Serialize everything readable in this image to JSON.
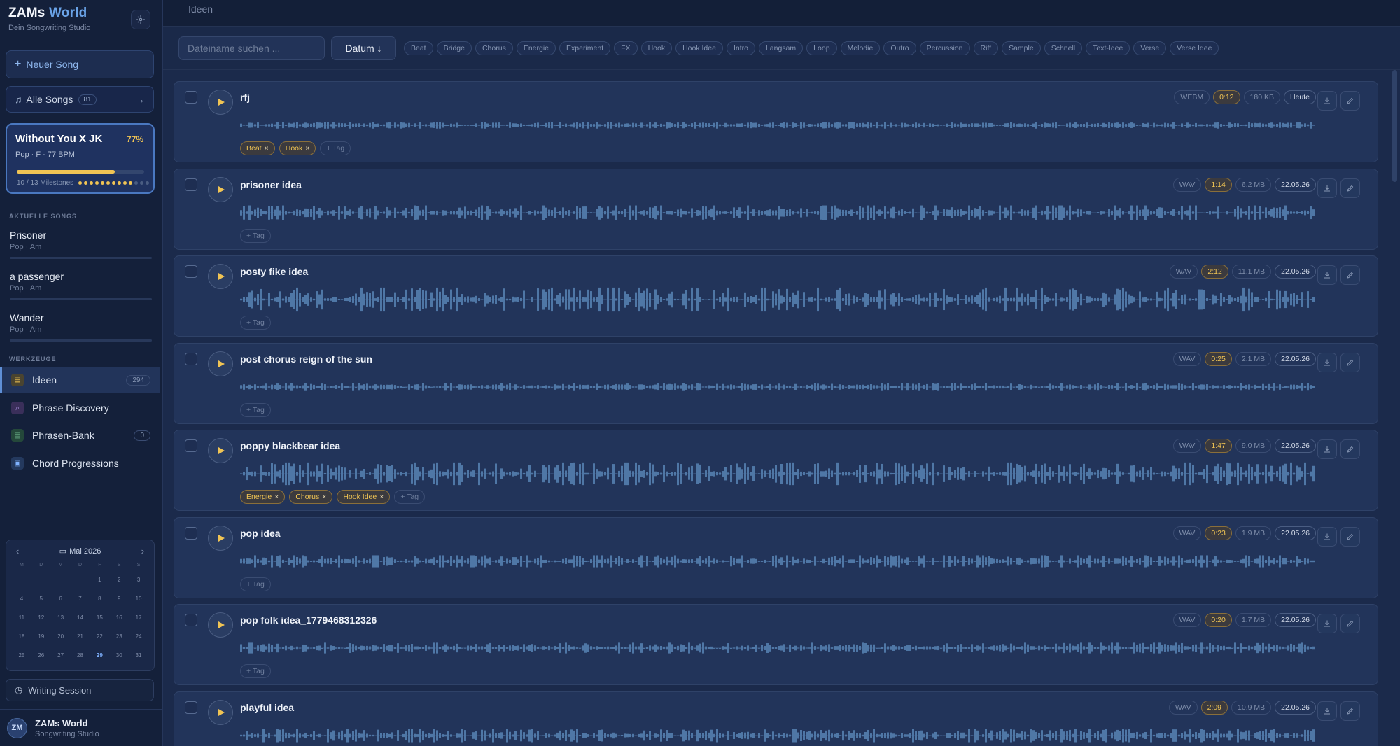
{
  "app": {
    "title_main": "ZAMs",
    "title_accent": "World",
    "subtitle": "Dein Songwriting Studio"
  },
  "sidebar": {
    "new_song": "Neuer Song",
    "all_songs": {
      "label": "Alle Songs",
      "count": "81"
    },
    "current_song": {
      "title": "Without You X JK",
      "percent": "77%",
      "progress": 0.77,
      "meta": "Pop · F · 77 BPM",
      "milestones": "10 / 13 Milestones",
      "milestones_done": 10,
      "milestones_total": 13
    },
    "recent_label": "AKTUELLE SONGS",
    "recent": [
      {
        "name": "Prisoner",
        "sub": "Pop · Am"
      },
      {
        "name": "a passenger",
        "sub": "Pop · Am"
      },
      {
        "name": "Wander",
        "sub": "Pop · Am"
      }
    ],
    "tools_label": "WERKZEUGE",
    "tools": [
      {
        "label": "Ideen",
        "badge": "294"
      },
      {
        "label": "Phrase Discovery",
        "badge": ""
      },
      {
        "label": "Phrasen-Bank",
        "badge": "0"
      },
      {
        "label": "Chord Progressions",
        "badge": ""
      }
    ],
    "calendar": {
      "month": "Mai 2026",
      "weekdays": [
        "M",
        "D",
        "M",
        "D",
        "F",
        "S",
        "S"
      ],
      "days": [
        "",
        "",
        "",
        "",
        "1",
        "2",
        "3",
        "4",
        "5",
        "6",
        "7",
        "8",
        "9",
        "10",
        "11",
        "12",
        "13",
        "14",
        "15",
        "16",
        "17",
        "18",
        "19",
        "20",
        "21",
        "22",
        "23",
        "24",
        "25",
        "26",
        "27",
        "28",
        "29",
        "30",
        "31"
      ],
      "today": "29"
    },
    "writing_session": "Writing Session",
    "footer": {
      "initials": "ZM",
      "name": "ZAMs World",
      "sub": "Songwriting Studio"
    }
  },
  "main": {
    "breadcrumb": "Ideen",
    "search_placeholder": "Dateiname suchen ...",
    "sort_label": "Datum ↓",
    "filter_tags": [
      "Beat",
      "Bridge",
      "Chorus",
      "Energie",
      "Experiment",
      "FX",
      "Hook",
      "Hook Idee",
      "Intro",
      "Langsam",
      "Loop",
      "Melodie",
      "Outro",
      "Percussion",
      "Riff",
      "Sample",
      "Schnell",
      "Text-Idee",
      "Verse",
      "Verse Idee"
    ],
    "add_tag_label": "+ Tag",
    "ideas": [
      {
        "title": "rfj",
        "format": "WEBM",
        "duration": "0:12",
        "size": "180 KB",
        "date": "Heute",
        "tags": [
          "Beat",
          "Hook"
        ]
      },
      {
        "title": "prisoner idea",
        "format": "WAV",
        "duration": "1:14",
        "size": "6.2 MB",
        "date": "22.05.26",
        "tags": []
      },
      {
        "title": "posty fike idea",
        "format": "WAV",
        "duration": "2:12",
        "size": "11.1 MB",
        "date": "22.05.26",
        "tags": []
      },
      {
        "title": "post chorus reign of the sun",
        "format": "WAV",
        "duration": "0:25",
        "size": "2.1 MB",
        "date": "22.05.26",
        "tags": []
      },
      {
        "title": "poppy blackbear idea",
        "format": "WAV",
        "duration": "1:47",
        "size": "9.0 MB",
        "date": "22.05.26",
        "tags": [
          "Energie",
          "Chorus",
          "Hook Idee"
        ]
      },
      {
        "title": "pop idea",
        "format": "WAV",
        "duration": "0:23",
        "size": "1.9 MB",
        "date": "22.05.26",
        "tags": []
      },
      {
        "title": "pop folk idea_1779468312326",
        "format": "WAV",
        "duration": "0:20",
        "size": "1.7 MB",
        "date": "22.05.26",
        "tags": []
      },
      {
        "title": "playful idea",
        "format": "WAV",
        "duration": "2:09",
        "size": "10.9 MB",
        "date": "22.05.26",
        "tags": []
      }
    ]
  }
}
